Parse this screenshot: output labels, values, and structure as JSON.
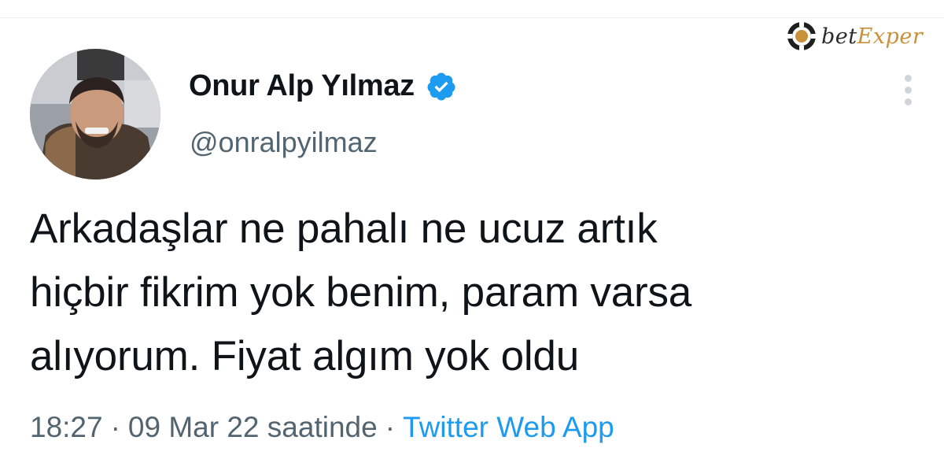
{
  "watermark": {
    "text_part1": "bet",
    "text_part2": "Exper",
    "colors": {
      "dark": "#2b2b2b",
      "gold": "#c8913a"
    }
  },
  "tweet": {
    "display_name": "Onur Alp Yılmaz",
    "username": "@onralpyilmaz",
    "verified": true,
    "text_lines": [
      "Arkadaşlar ne pahalı ne ucuz artık",
      "hiçbir fikrim yok benim, param varsa",
      "alıyorum. Fiyat algım yok oldu"
    ],
    "time": "18:27",
    "date": "09 Mar 22 saatinde",
    "separator": "·",
    "source": "Twitter Web App"
  },
  "icons": {
    "verified": "verified-badge-icon",
    "more": "more-vertical-icon",
    "watermark_logo": "casino-chip-icon"
  },
  "colors": {
    "text_primary": "#0f1419",
    "text_secondary": "#536471",
    "link": "#1d9bf0",
    "verified": "#1d9bf0"
  }
}
